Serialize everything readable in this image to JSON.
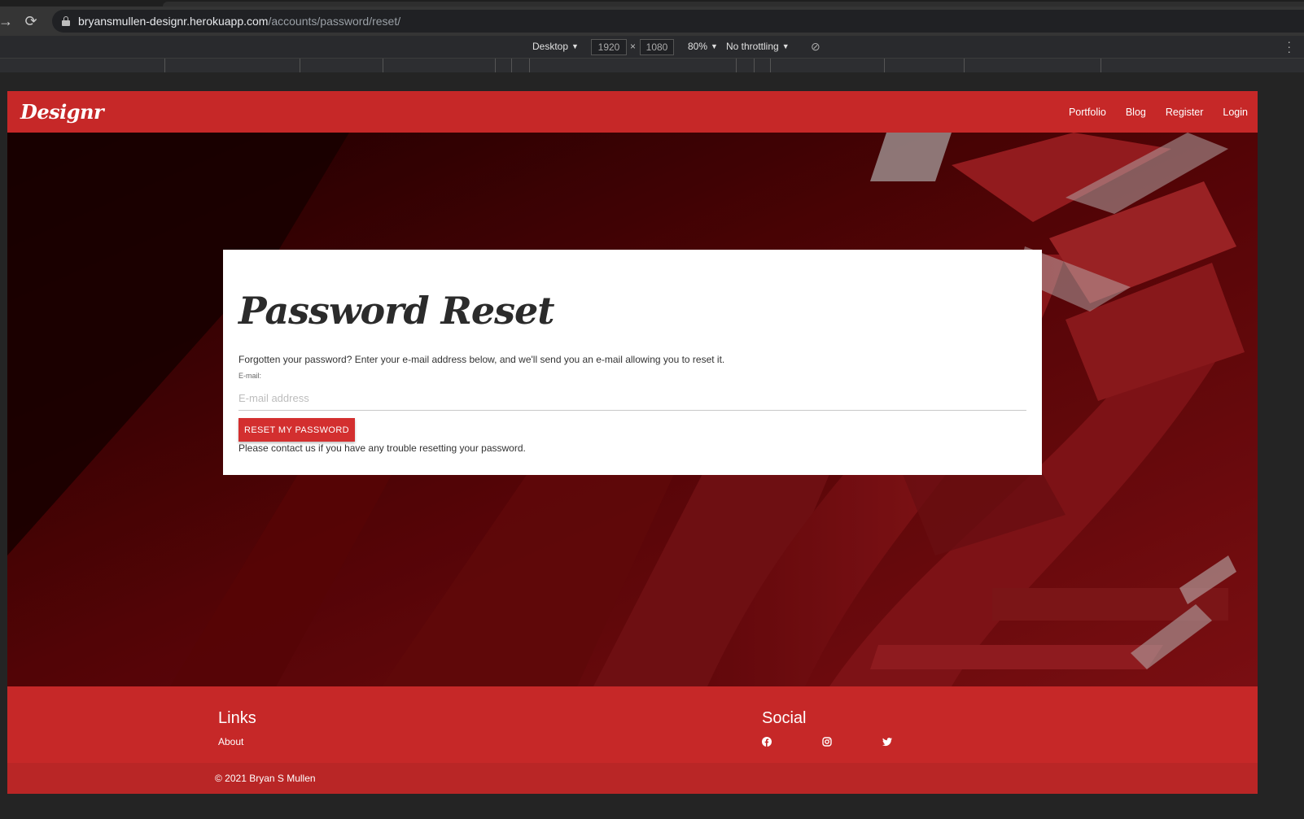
{
  "browser": {
    "url_host": "bryansmullen-designr.herokuapp.com",
    "url_path": "/accounts/password/reset/",
    "devtools": {
      "device": "Desktop",
      "width": "1920",
      "times": "×",
      "height": "1080",
      "zoom": "80%",
      "throttling": "No throttling"
    }
  },
  "site": {
    "brand": "Designr",
    "nav": [
      "Portfolio",
      "Blog",
      "Register",
      "Login"
    ]
  },
  "reset_card": {
    "title": "Password Reset",
    "intro": "Forgotten your password? Enter your e-mail address below, and we'll send you an e-mail allowing you to reset it.",
    "email_label": "E-mail:",
    "email_placeholder": "E-mail address",
    "email_value": "",
    "submit_label": "RESET MY PASSWORD",
    "help_text": "Please contact us if you have any trouble resetting your password."
  },
  "footer": {
    "links_heading": "Links",
    "about_link": "About",
    "social_heading": "Social",
    "social_icons": [
      "facebook-icon",
      "instagram-icon",
      "twitter-icon"
    ],
    "copyright": "© 2021 Bryan S Mullen"
  },
  "colors": {
    "brand_red": "#c62828",
    "button_red": "#d32f2f",
    "footer_bottom": "#b92626"
  }
}
